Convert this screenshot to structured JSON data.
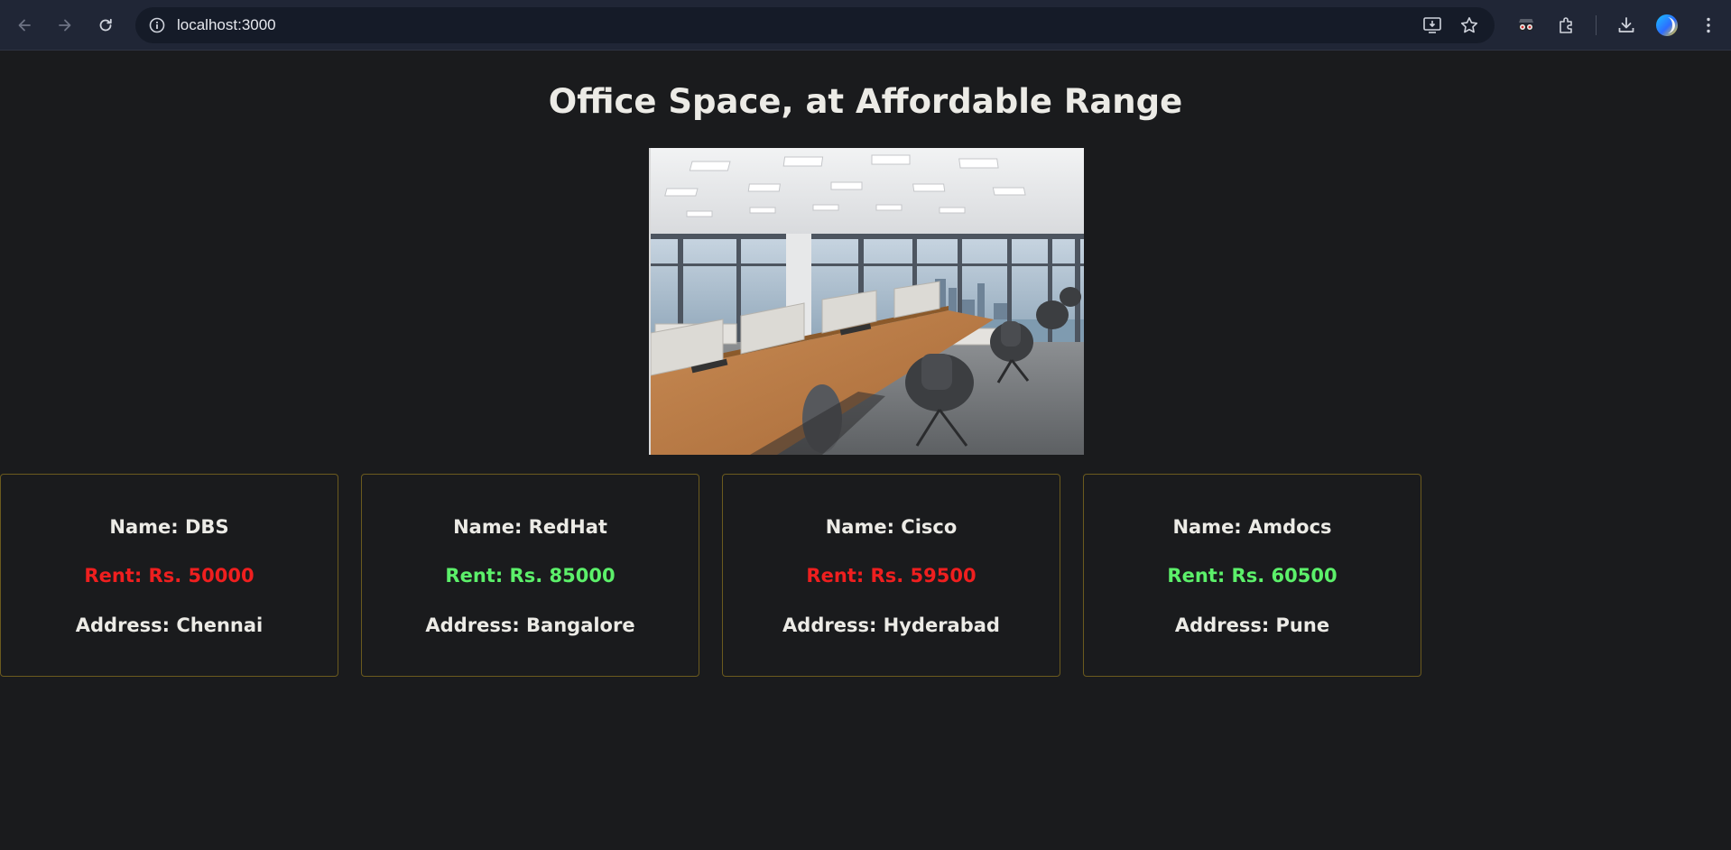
{
  "browser": {
    "url": "localhost:3000",
    "icons": {
      "back": "arrow-left-icon",
      "forward": "arrow-right-icon",
      "reload": "reload-icon",
      "site_info": "info-icon",
      "install": "install-app-icon",
      "bookmark": "star-icon",
      "extension1": "spy-extension-icon",
      "extensions": "puzzle-icon",
      "downloads": "download-icon",
      "profile": "profile-avatar-icon",
      "menu": "kebab-menu-icon"
    }
  },
  "page": {
    "title": "Office Space, at Affordable Range",
    "hero_image": "office-interior-photo"
  },
  "offices": [
    {
      "name": "Name: DBS",
      "rent": "Rent: Rs. 50000",
      "address": "Address: Chennai",
      "rent_value": 50000,
      "rent_color": "#ef1f1f"
    },
    {
      "name": "Name: RedHat",
      "rent": "Rent: Rs. 85000",
      "address": "Address: Bangalore",
      "rent_value": 85000,
      "rent_color": "#5cf06a"
    },
    {
      "name": "Name: Cisco",
      "rent": "Rent: Rs. 59500",
      "address": "Address: Hyderabad",
      "rent_value": 59500,
      "rent_color": "#ef1f1f"
    },
    {
      "name": "Name: Amdocs",
      "rent": "Rent: Rs. 60500",
      "address": "Address: Pune",
      "rent_value": 60500,
      "rent_color": "#5cf06a"
    }
  ],
  "colors": {
    "background": "#1a1b1d",
    "card_border": "#6b5a1e",
    "text": "#ecebe6",
    "rent_high": "#ef1f1f",
    "rent_low": "#5cf06a"
  }
}
